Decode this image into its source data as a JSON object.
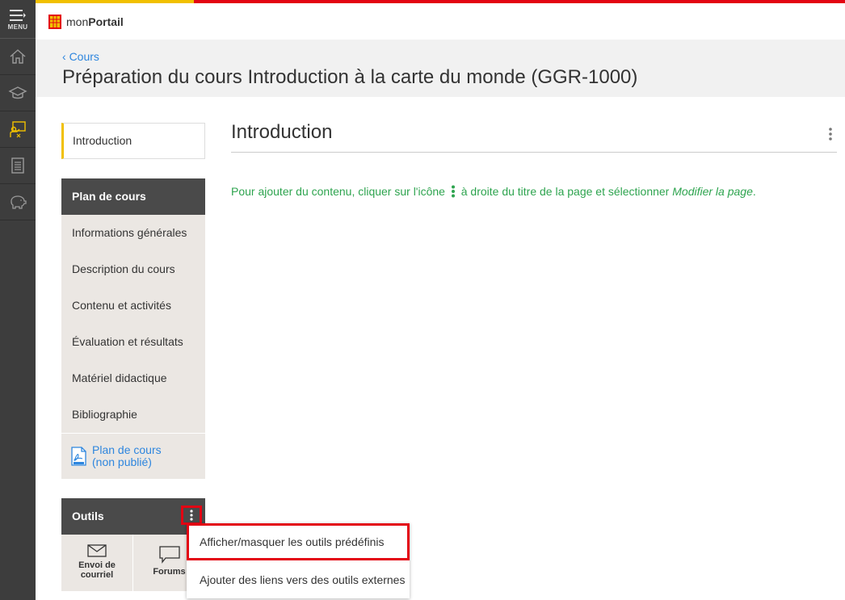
{
  "rail": {
    "menu_label": "MENU"
  },
  "header": {
    "brand_prefix": "mon",
    "brand_bold": "Portail"
  },
  "breadcrumb": {
    "back_label": "Cours"
  },
  "page": {
    "title": "Préparation du cours Introduction à la carte du monde (GGR-1000)"
  },
  "nav": {
    "intro_label": "Introduction",
    "plan_heading": "Plan de cours",
    "plan_items": [
      "Informations générales",
      "Description du cours",
      "Contenu et activités",
      "Évaluation et résultats",
      "Matériel didactique",
      "Bibliographie"
    ],
    "pdf_line1": "Plan de cours",
    "pdf_line2": "(non publié)",
    "tools_heading": "Outils",
    "tools": [
      {
        "label_line1": "Envoi de",
        "label_line2": "courriel",
        "icon": "envelope-icon"
      },
      {
        "label_line1": "Forums",
        "label_line2": "",
        "icon": "speech-bubble-icon"
      }
    ]
  },
  "main": {
    "title": "Introduction",
    "hint_before": "Pour ajouter du contenu, cliquer sur l'icône",
    "hint_after": "à droite du titre de la page et sélectionner",
    "hint_italic": "Modifier la page",
    "hint_end": "."
  },
  "dropdown": {
    "options": [
      "Afficher/masquer les outils prédéfinis",
      "Ajouter des liens vers des outils externes"
    ]
  },
  "colors": {
    "accent_yellow": "#f1c000",
    "accent_red": "#e30513",
    "link_blue": "#2e86de",
    "hint_green": "#2ea44f",
    "rail_bg": "#3d3d3d"
  }
}
